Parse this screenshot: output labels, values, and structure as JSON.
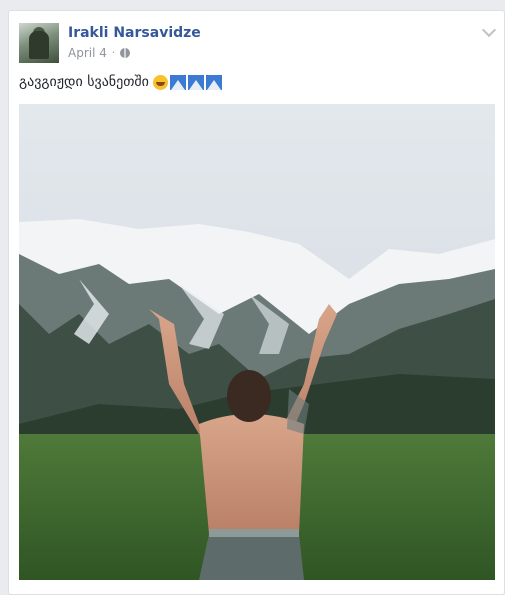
{
  "post": {
    "author": "Irakli Narsavidze",
    "date": "April 4",
    "separator": "·",
    "text": "გავგიჟდი სვანეთში",
    "emojis": [
      "laughing-tears-emoji",
      "mountain-emoji",
      "mountain-emoji",
      "mountain-emoji"
    ],
    "privacy_icon": "globe-icon",
    "menu_icon": "chevron-down-icon",
    "photo_description": "shirtless man raising hands toward snowy mountains in a green valley"
  },
  "colors": {
    "author_link": "#365899",
    "meta_text": "#90949c",
    "body_text": "#1d2129",
    "page_bg": "#e9ebee"
  }
}
